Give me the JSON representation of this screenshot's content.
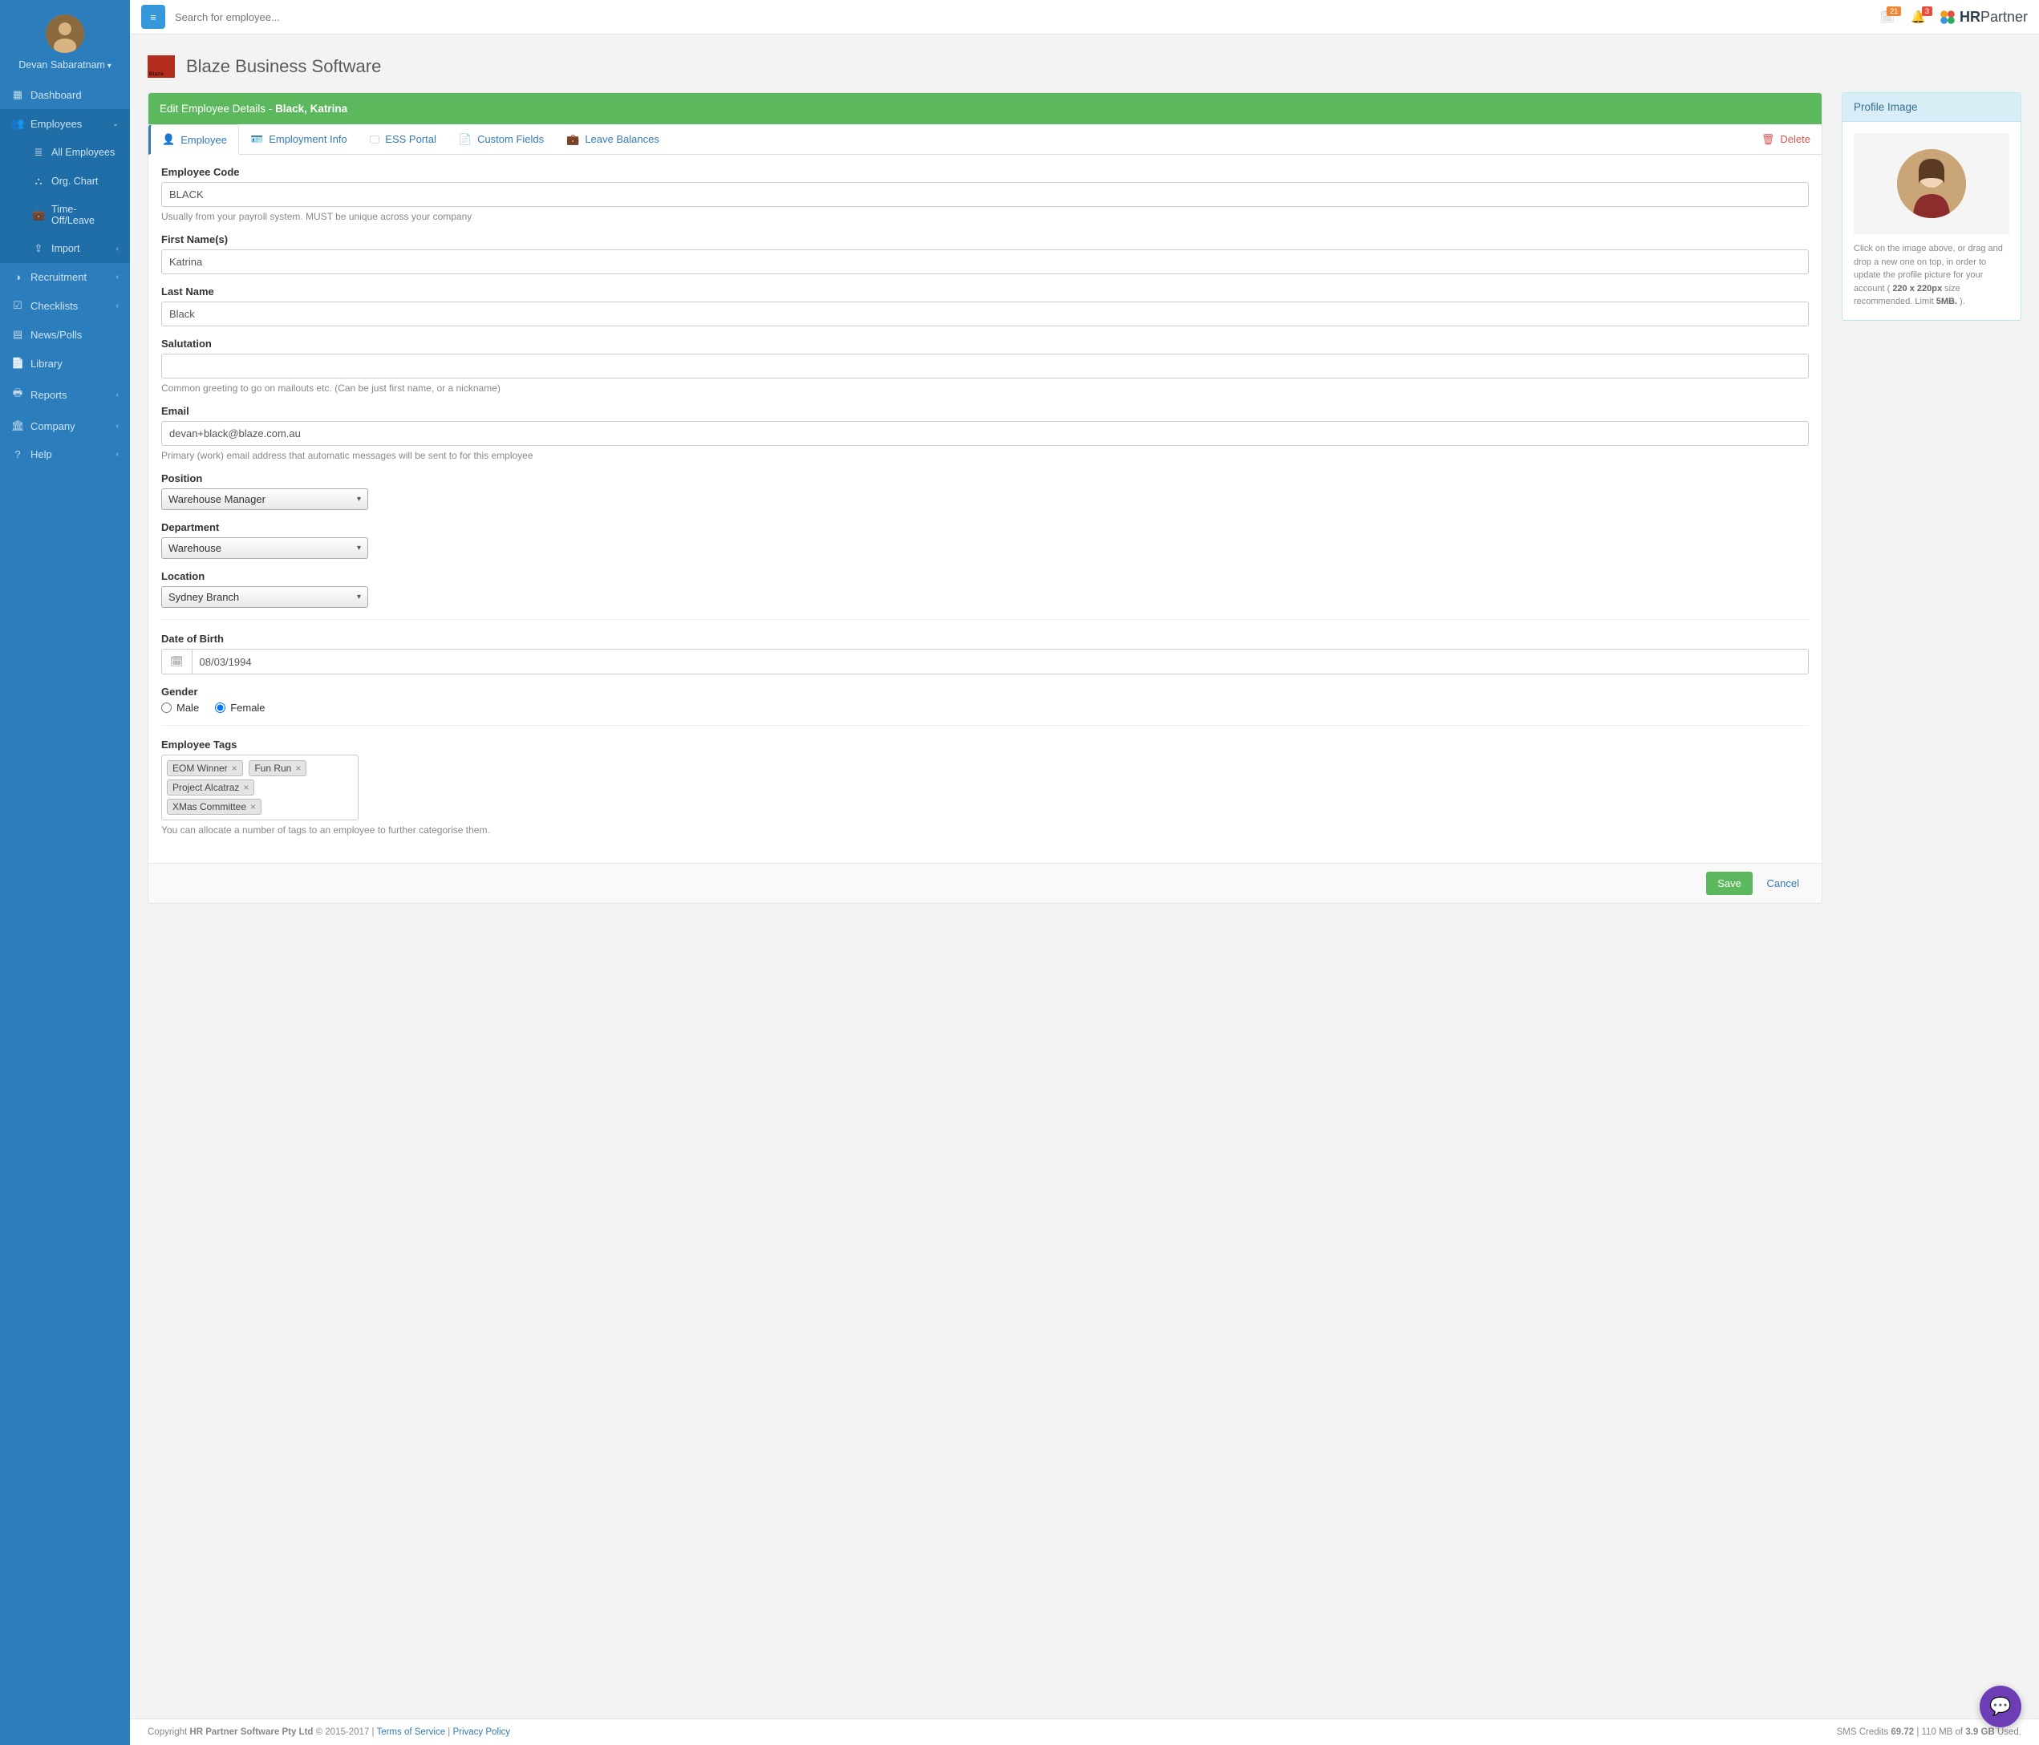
{
  "user": {
    "name": "Devan Sabaratnam"
  },
  "sidebar": {
    "items": [
      {
        "label": "Dashboard",
        "icon": "▦"
      },
      {
        "label": "Employees",
        "icon": "👥",
        "expanded": true,
        "chev": "⌄",
        "children": [
          {
            "label": "All Employees",
            "icon": "≣"
          },
          {
            "label": "Org. Chart",
            "icon": "⛬"
          },
          {
            "label": "Time-Off/Leave",
            "icon": "⏱"
          },
          {
            "label": "Import",
            "icon": "⇪",
            "chev": "‹"
          }
        ]
      },
      {
        "label": "Recruitment",
        "icon": "◑",
        "chev": "‹"
      },
      {
        "label": "Checklists",
        "icon": "☑",
        "chev": "‹"
      },
      {
        "label": "News/Polls",
        "icon": "▤"
      },
      {
        "label": "Library",
        "icon": "📄"
      },
      {
        "label": "Reports",
        "icon": "🖶",
        "chev": "‹"
      },
      {
        "label": "Company",
        "icon": "🏛",
        "chev": "‹"
      },
      {
        "label": "Help",
        "icon": "?",
        "chev": "‹"
      }
    ]
  },
  "topbar": {
    "search_placeholder": "Search for employee...",
    "badge1": "21",
    "badge2": "3",
    "brand_prefix": "HR",
    "brand_suffix": "Partner"
  },
  "company": {
    "logo_label": "Blaze",
    "title": "Blaze Business Software"
  },
  "panel": {
    "header_prefix": "Edit Employee Details - ",
    "header_name": "Black, Katrina",
    "tabs": [
      {
        "label": "Employee"
      },
      {
        "label": "Employment Info"
      },
      {
        "label": "ESS Portal"
      },
      {
        "label": "Custom Fields"
      },
      {
        "label": "Leave Balances"
      },
      {
        "label": "Delete"
      }
    ]
  },
  "form": {
    "code": {
      "label": "Employee Code",
      "value": "BLACK",
      "help": "Usually from your payroll system. MUST be unique across your company"
    },
    "first": {
      "label": "First Name(s)",
      "value": "Katrina"
    },
    "last": {
      "label": "Last Name",
      "value": "Black"
    },
    "salutation": {
      "label": "Salutation",
      "value": "",
      "help": "Common greeting to go on mailouts etc. (Can be just first name, or a nickname)"
    },
    "email": {
      "label": "Email",
      "value": "devan+black@blaze.com.au",
      "help": "Primary (work) email address that automatic messages will be sent to for this employee"
    },
    "position": {
      "label": "Position",
      "value": "Warehouse Manager"
    },
    "department": {
      "label": "Department",
      "value": "Warehouse"
    },
    "location": {
      "label": "Location",
      "value": "Sydney Branch"
    },
    "dob": {
      "label": "Date of Birth",
      "value": "08/03/1994"
    },
    "gender": {
      "label": "Gender",
      "male": "Male",
      "female": "Female"
    },
    "tags": {
      "label": "Employee Tags",
      "items": [
        "EOM Winner",
        "Fun Run",
        "Project Alcatraz",
        "XMas Committee"
      ],
      "help": "You can allocate a number of tags to an employee to further categorise them."
    }
  },
  "actions": {
    "save": "Save",
    "cancel": "Cancel"
  },
  "side": {
    "title": "Profile Image",
    "help_1": "Click on the image above, or drag and drop a new one on top, in order to update the profile picture for your account ( ",
    "help_bold1": "220 x 220px",
    "help_2": " size recommended. Limit ",
    "help_bold2": "5MB.",
    "help_3": " )."
  },
  "footer": {
    "copyright_prefix": "Copyright ",
    "company": "HR Partner Software Pty Ltd",
    "copyright_suffix": " © 2015-2017 | ",
    "tos": "Terms of Service",
    "sep": " | ",
    "privacy": "Privacy Policy",
    "sms_prefix": "SMS Credits ",
    "sms_credits": "69.72",
    "storage_mid1": " | 110 MB of ",
    "storage_total": "3.9 GB",
    "storage_suffix": " Used."
  }
}
